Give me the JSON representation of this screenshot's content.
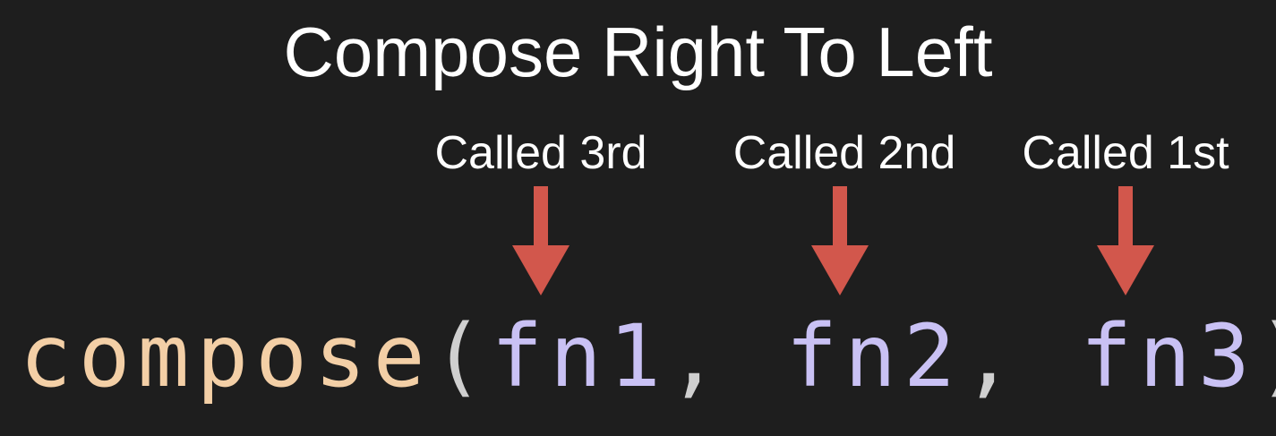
{
  "title": "Compose Right To Left",
  "labels": {
    "third": "Called 3rd",
    "second": "Called 2nd",
    "first": "Called 1st"
  },
  "code": {
    "func": "compose",
    "open_paren": "(",
    "arg1": "fn1",
    "comma1": ", ",
    "arg2": "fn2",
    "comma2": ", ",
    "arg3": "fn3",
    "close_paren": ")"
  },
  "colors": {
    "background": "#1e1e1e",
    "title_text": "#ffffff",
    "arrow": "#d2574c",
    "func_name": "#f3cfa6",
    "argument": "#c9c1f4",
    "punctuation": "#cfcfcf"
  },
  "icons": {
    "arrow": "down-arrow-icon"
  }
}
